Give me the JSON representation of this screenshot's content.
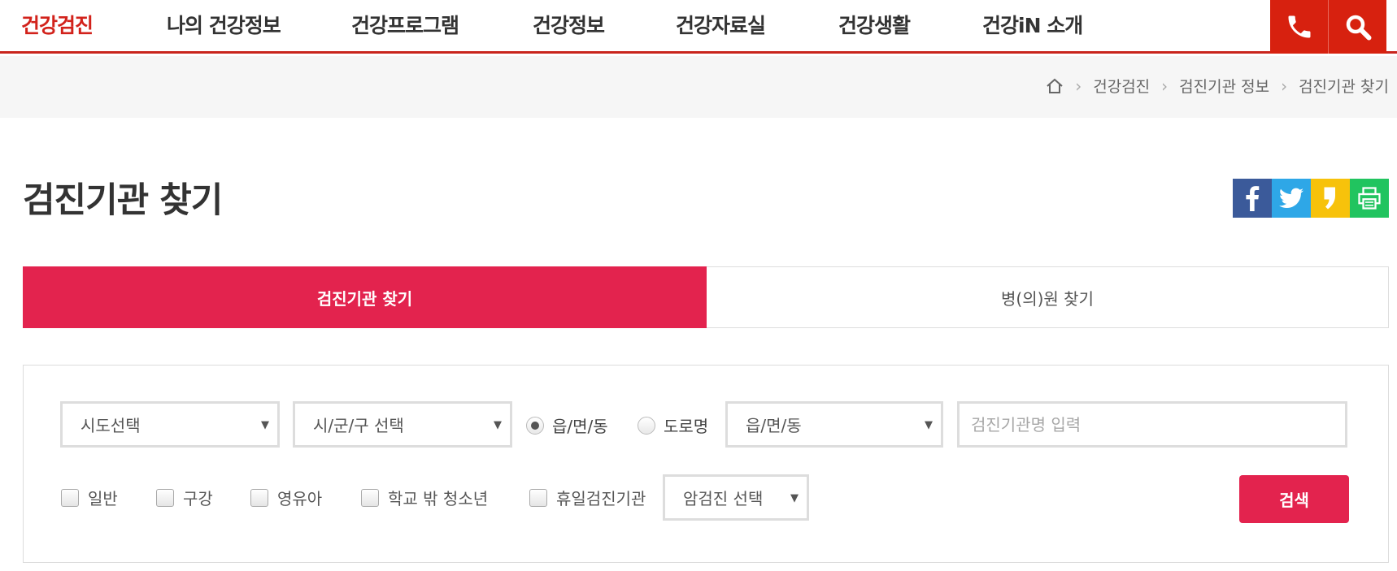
{
  "nav": {
    "items": [
      {
        "label": "건강검진"
      },
      {
        "label": "나의 건강정보"
      },
      {
        "label": "건강프로그램"
      },
      {
        "label": "건강정보"
      },
      {
        "label": "건강자료실"
      },
      {
        "label": "건강생활"
      },
      {
        "label": "건강iN 소개"
      }
    ],
    "active_index": 0,
    "phone_icon": "phone-icon",
    "search_icon": "search-icon"
  },
  "breadcrumb": {
    "home_icon": "home-icon",
    "items": [
      "건강검진",
      "검진기관 정보",
      "검진기관 찾기"
    ]
  },
  "page_title": "검진기관 찾기",
  "share": {
    "facebook_icon": "facebook-icon",
    "twitter_icon": "twitter-icon",
    "kakaostory_icon": "kakaostory-icon",
    "print_icon": "print-icon",
    "colors": {
      "facebook": "#3b5a9a",
      "twitter": "#2ea7e7",
      "kakaostory": "#f7c20b",
      "print": "#21c45f"
    }
  },
  "tabs": {
    "active": "검진기관 찾기",
    "inactive": "병(의)원 찾기"
  },
  "search": {
    "sido_select": "시도선택",
    "sigungu_select": "시/군/구 선택",
    "radio_eup": "읍/면/동",
    "radio_road": "도로명",
    "radio_selected": "읍/면/동",
    "eup_select": "읍/면/동",
    "name_placeholder": "검진기관명 입력",
    "checks": [
      "일반",
      "구강",
      "영유아",
      "학교 밖 청소년",
      "휴일검진기관"
    ],
    "cancer_select": "암검진 선택",
    "submit": "검색"
  },
  "colors": {
    "nav_active": "#d2221b",
    "nav_button": "#d7210f",
    "accent": "#e3234e"
  }
}
